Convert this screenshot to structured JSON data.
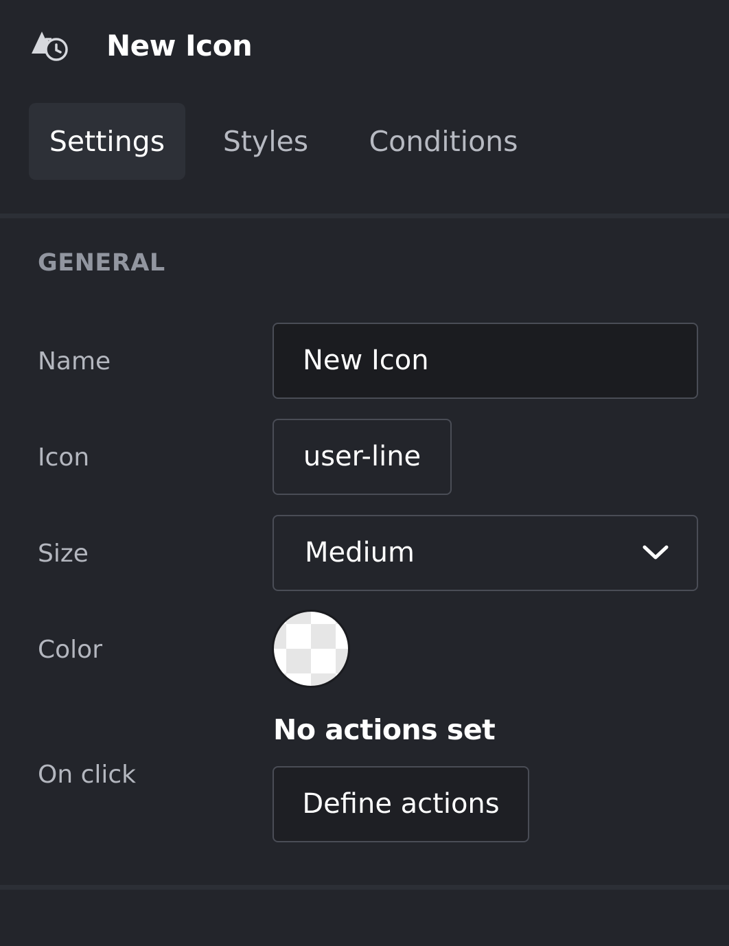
{
  "header": {
    "icon": "shapes-history-icon",
    "title": "New Icon"
  },
  "tabs": [
    {
      "label": "Settings",
      "active": true
    },
    {
      "label": "Styles",
      "active": false
    },
    {
      "label": "Conditions",
      "active": false
    }
  ],
  "general": {
    "section_title": "GENERAL",
    "name": {
      "label": "Name",
      "value": "New Icon"
    },
    "icon": {
      "label": "Icon",
      "value": "user-line"
    },
    "size": {
      "label": "Size",
      "value": "Medium",
      "icon": "chevron-down-icon"
    },
    "color": {
      "label": "Color",
      "value": "transparent"
    },
    "on_click": {
      "label": "On click",
      "status": "No actions set",
      "button_label": "Define actions"
    }
  },
  "colors": {
    "background": "#23252b",
    "active_tab": "#2d3037",
    "input_background": "#1b1c20",
    "border": "#4a4d56"
  }
}
